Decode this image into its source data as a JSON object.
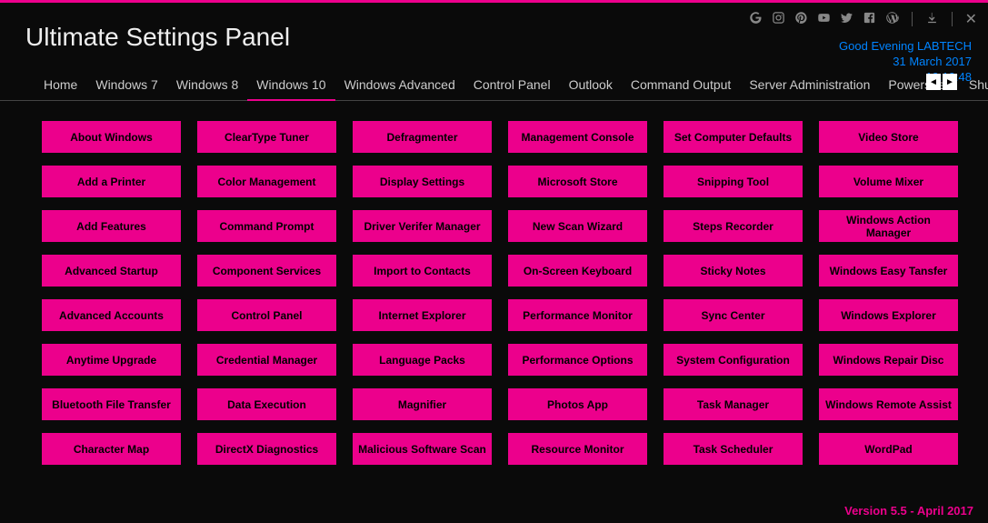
{
  "app_title": "Ultimate Settings Panel",
  "greeting": {
    "line1": "Good Evening LABTECH",
    "line2": "31 March 2017",
    "line3": "19:19:48"
  },
  "tabs": [
    {
      "label": "Home",
      "active": false
    },
    {
      "label": "Windows 7",
      "active": false
    },
    {
      "label": "Windows 8",
      "active": false
    },
    {
      "label": "Windows 10",
      "active": true
    },
    {
      "label": "Windows Advanced",
      "active": false
    },
    {
      "label": "Control Panel",
      "active": false
    },
    {
      "label": "Outlook",
      "active": false
    },
    {
      "label": "Command Output",
      "active": false
    },
    {
      "label": "Server Administration",
      "active": false
    },
    {
      "label": "Powershell",
      "active": false
    },
    {
      "label": "Shutdown O",
      "active": false
    }
  ],
  "grid_buttons": [
    "About Windows",
    "ClearType Tuner",
    "Defragmenter",
    "Management Console",
    "Set Computer Defaults",
    "Video Store",
    "Add a Printer",
    "Color Management",
    "Display Settings",
    "Microsoft Store",
    "Snipping Tool",
    "Volume Mixer",
    "Add Features",
    "Command Prompt",
    "Driver Verifer Manager",
    "New Scan Wizard",
    "Steps Recorder",
    "Windows Action Manager",
    "Advanced Startup",
    "Component Services",
    "Import to Contacts",
    "On-Screen Keyboard",
    "Sticky Notes",
    "Windows Easy Tansfer",
    "Advanced Accounts",
    "Control Panel",
    "Internet Explorer",
    "Performance Monitor",
    "Sync Center",
    "Windows Explorer",
    "Anytime Upgrade",
    "Credential Manager",
    "Language Packs",
    "Performance Options",
    "System Configuration",
    "Windows Repair Disc",
    "Bluetooth File Transfer",
    "Data Execution",
    "Magnifier",
    "Photos App",
    "Task Manager",
    "Windows Remote Assist",
    "Character Map",
    "DirectX Diagnostics",
    "Malicious Software Scan",
    "Resource Monitor",
    "Task Scheduler",
    "WordPad"
  ],
  "footer_text": "Version 5.5 - April 2017",
  "scroll_left": "◄",
  "scroll_right": "►",
  "titlebar_close": "✕"
}
